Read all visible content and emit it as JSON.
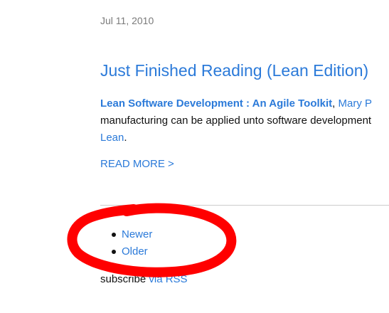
{
  "post": {
    "date": "Jul 11, 2010",
    "title": "Just Finished Reading (Lean Edition)",
    "excerpt": {
      "book_title": "Lean Software Development : An Agile Toolkit",
      "separator": ", ",
      "author_partial": "Mary P",
      "line2": "manufacturing can be applied unto software development",
      "line3_link": "Lean",
      "line3_punct": "."
    },
    "read_more": "READ MORE >"
  },
  "pagination": {
    "newer": "Newer",
    "older": "Older"
  },
  "footer": {
    "subscribe_text": "subscribe",
    "rss_link": "via RSS"
  },
  "annotation": {
    "color": "#ff0000"
  },
  "colors": {
    "link": "#2b7ad9",
    "date": "#7a7a7a",
    "text": "#111111"
  }
}
